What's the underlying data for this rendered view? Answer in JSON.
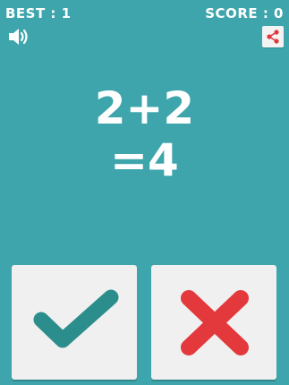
{
  "hud": {
    "best_text": "BEST : 1",
    "score_text": "SCORE : 0"
  },
  "icons": {
    "sound": "speaker-icon",
    "share": "share-icon",
    "true": "checkmark-icon",
    "false": "cross-icon"
  },
  "equation": {
    "line1": "2+2",
    "line2": "=4"
  },
  "colors": {
    "background": "#3da5ab",
    "check": "#2b8e8c",
    "cross": "#e3383c",
    "button": "#f0f0f0",
    "text": "#ffffff"
  }
}
